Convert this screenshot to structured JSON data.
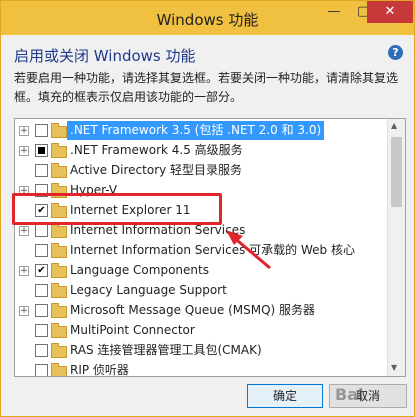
{
  "window": {
    "title": "Windows 功能",
    "minimize_glyph": "—",
    "maximize_glyph": "▢",
    "close_glyph": "✕"
  },
  "heading": "启用或关闭 Windows 功能",
  "help_glyph": "?",
  "description": "若要启用一种功能，请选择其复选框。若要关闭一种功能，请清除其复选框。填充的框表示仅启用该功能的一部分。",
  "features": [
    {
      "label": ".NET Framework 3.5 (包括 .NET 2.0 和 3.0)",
      "expander": "+",
      "state": "unchecked",
      "selected": true
    },
    {
      "label": ".NET Framework 4.5 高级服务",
      "expander": "+",
      "state": "partial",
      "selected": false
    },
    {
      "label": "Active Directory 轻型目录服务",
      "expander": "",
      "state": "unchecked",
      "selected": false
    },
    {
      "label": "Hyper-V",
      "expander": "+",
      "state": "unchecked",
      "selected": false
    },
    {
      "label": "Internet Explorer 11",
      "expander": "",
      "state": "checked",
      "selected": false
    },
    {
      "label": "Internet Information Services",
      "expander": "+",
      "state": "unchecked",
      "selected": false
    },
    {
      "label": "Internet Information Services 可承载的 Web 核心",
      "expander": "",
      "state": "unchecked",
      "selected": false
    },
    {
      "label": "Language Components",
      "expander": "+",
      "state": "checked",
      "selected": false
    },
    {
      "label": "Legacy Language Support",
      "expander": "",
      "state": "unchecked",
      "selected": false
    },
    {
      "label": "Microsoft Message Queue (MSMQ) 服务器",
      "expander": "+",
      "state": "unchecked",
      "selected": false
    },
    {
      "label": "MultiPoint Connector",
      "expander": "",
      "state": "unchecked",
      "selected": false
    },
    {
      "label": "RAS 连接管理器管理工具包(CMAK)",
      "expander": "",
      "state": "unchecked",
      "selected": false
    },
    {
      "label": "RIP 侦听器",
      "expander": "",
      "state": "unchecked",
      "selected": false
    }
  ],
  "buttons": {
    "ok": "确定",
    "cancel": "取消"
  },
  "watermark": "Bai"
}
